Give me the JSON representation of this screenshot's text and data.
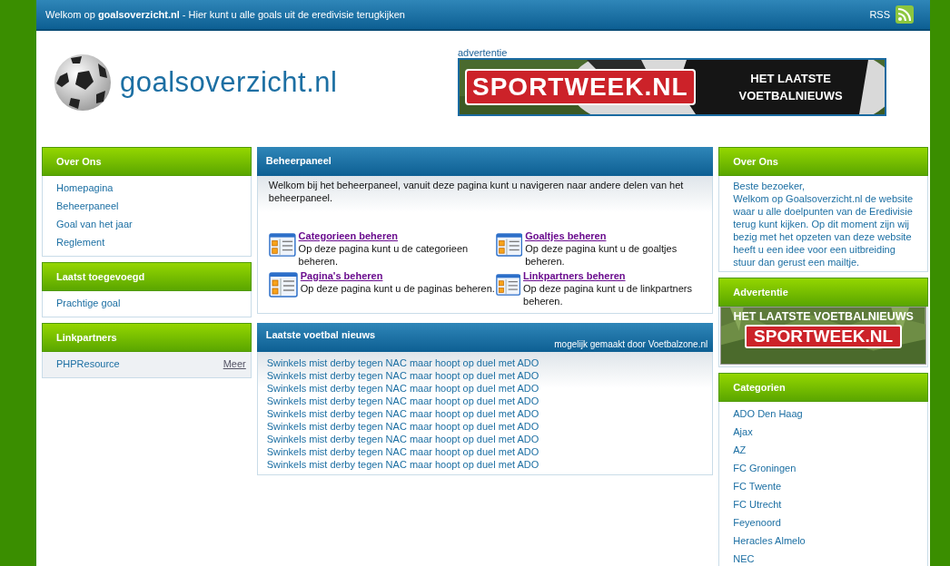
{
  "top_bar": {
    "welcome": "Welkom op **goalsoverzicht.nl** - Hier kunt u alle goals uit de eredivisie terugkijken",
    "rss": "RSS"
  },
  "logo": {
    "text": "goalsoverzicht.nl"
  },
  "header_ad": {
    "label": "advertentie",
    "brand": "SPORTWEEK.NL",
    "slogan_1": "HET LAATSTE",
    "slogan_2": "VOETBALNIEUWS"
  },
  "left_sidebar": [
    {
      "title": "Over Ons",
      "items": [
        {
          "label": "Homepagina"
        },
        {
          "label": "Beheerpaneel"
        },
        {
          "label": "Goal van het jaar"
        },
        {
          "label": "Reglement"
        }
      ]
    },
    {
      "title": "Laatst toegevoegd",
      "items": [
        {
          "label": "Prachtige goal"
        }
      ]
    },
    {
      "title": "Linkpartners",
      "items": [
        {
          "label": "PHPResource",
          "more": "Meer"
        }
      ]
    }
  ],
  "admin_panel": {
    "title": "Beheerpaneel",
    "intro": "Welkom bij het beheerpaneel, vanuit deze pagina kunt u navigeren naar andere delen van het beheerpaneel.",
    "sections": [
      {
        "link": "Categorieen beheren",
        "description": "Op deze pagina kunt u de categorieen beheren."
      },
      {
        "link": "Goaltjes beheren",
        "description": "Op deze pagina kunt u de goaltjes beheren."
      },
      {
        "link": "Pagina's beheren",
        "description": "Op deze pagina kunt u de paginas beheren."
      },
      {
        "link": "Linkpartners beheren",
        "description": "Op deze pagina kunt u de linkpartners beheren."
      }
    ]
  },
  "news_panel": {
    "title": "Laatste voetbal nieuws",
    "credit": "mogelijk gemaakt door Voetbalzone.nl",
    "items": [
      "Swinkels mist derby tegen NAC maar hoopt op duel met ADO",
      "Swinkels mist derby tegen NAC maar hoopt op duel met ADO",
      "Swinkels mist derby tegen NAC maar hoopt op duel met ADO",
      "Swinkels mist derby tegen NAC maar hoopt op duel met ADO",
      "Swinkels mist derby tegen NAC maar hoopt op duel met ADO",
      "Swinkels mist derby tegen NAC maar hoopt op duel met ADO",
      "Swinkels mist derby tegen NAC maar hoopt op duel met ADO",
      "Swinkels mist derby tegen NAC maar hoopt op duel met ADO",
      "Swinkels mist derby tegen NAC maar hoopt op duel met ADO"
    ]
  },
  "right_sidebar": {
    "about": {
      "title": "Over Ons",
      "greeting": "Beste bezoeker,",
      "text": "Welkom op Goalsoverzicht.nl de website waar u alle doelpunten van de Eredivisie terug kunt kijken. Op dit moment zijn wij bezig met het opzeten van deze website heeft u een idee voor een uitbreiding stuur dan gerust een mailtje."
    },
    "ad": {
      "title": "Advertentie",
      "slogan": "HET LAATSTE VOETBALNIEUWS",
      "brand": "SPORTWEEK.NL"
    },
    "categories": {
      "title": "Categorien",
      "items": [
        "ADO Den Haag",
        "Ajax",
        "AZ",
        "FC Groningen",
        "FC Twente",
        "FC Utrecht",
        "Feyenoord",
        "Heracles Almelo",
        "NEC"
      ]
    }
  }
}
